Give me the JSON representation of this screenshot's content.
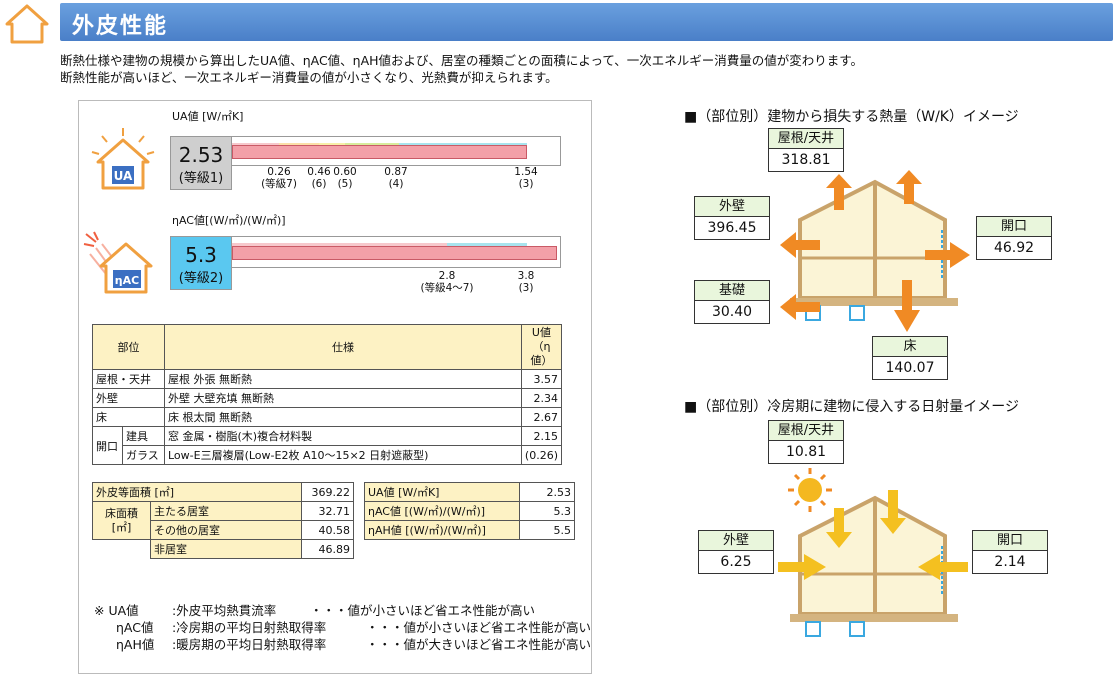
{
  "header": {
    "title": "外皮性能"
  },
  "description": [
    "断熱仕様や建物の規模から算出したUA値、ηAC値、ηAH値および、居室の種類ごとの面積によって、一次エネルギー消費量の値が変わります。",
    "断熱性能が高いほど、一次エネルギー消費量の値が小さくなり、光熱費が抑えられます。"
  ],
  "ua": {
    "label": "UA値 [W/㎡K]",
    "value": "2.53",
    "grade": "(等級1)",
    "value_fraction": 0.9,
    "ticks": [
      "0.26",
      "0.46",
      "0.60",
      "0.87",
      "1.54"
    ],
    "grades": [
      "(等級7)",
      "(6)",
      "(5)",
      "(4)",
      "(3)"
    ],
    "icon_text": "UA"
  },
  "eta_ac": {
    "label": "ηAC値[(W/㎡)/(W/㎡)]",
    "value": "5.3",
    "grade": "(等級2)",
    "value_fraction": 0.99,
    "ticks": [
      "2.8",
      "3.8"
    ],
    "grades": [
      "(等級4〜7)",
      "(3)"
    ],
    "icon_text": "ηAC"
  },
  "spec_table": {
    "headers": {
      "part": "部位",
      "spec": "仕様",
      "u": "U値",
      "u_sub": "（η値）"
    },
    "rows": [
      {
        "part": "屋根・天井",
        "spec": "屋根 外張 無断熱",
        "u": "3.57"
      },
      {
        "part": "外壁",
        "spec": "外壁 大壁充填 無断熱",
        "u": "2.34"
      },
      {
        "part": "床",
        "spec": "床 根太間 無断熱",
        "u": "2.67"
      },
      {
        "part": "開口",
        "sub": "建具",
        "spec": "窓 金属・樹脂(木)複合材料製",
        "u": "2.15"
      },
      {
        "part": "",
        "sub": "ガラス",
        "spec": "Low-E三層複層(Low-E2枚 A10〜15×2 日射遮蔽型)",
        "u": "(0.26)"
      }
    ]
  },
  "area_table": {
    "envelope_label": "外皮等面積 [㎡]",
    "envelope_value": "369.22",
    "floor_label": "床面積",
    "floor_unit": "[㎡]",
    "rows": [
      {
        "label": "主たる居室",
        "value": "32.71"
      },
      {
        "label": "その他の居室",
        "value": "40.58"
      },
      {
        "label": "非居室",
        "value": "46.89"
      }
    ]
  },
  "value_table": [
    {
      "label": "UA値 [W/㎡K]",
      "value": "2.53"
    },
    {
      "label": "ηAC値 [(W/㎡)/(W/㎡)]",
      "value": "5.3"
    },
    {
      "label": "ηAH値 [(W/㎡)/(W/㎡)]",
      "value": "5.5"
    }
  ],
  "notes": [
    {
      "key": "※ UA値",
      "def": ":外皮平均熱貫流率",
      "remark": "・・・値が小さいほど省エネ性能が高い"
    },
    {
      "key": "ηAC値",
      "def": ":冷房期の平均日射熱取得率",
      "remark": "・・・値が小さいほど省エネ性能が高い"
    },
    {
      "key": "ηAH値",
      "def": ":暖房期の平均日射熱取得率",
      "remark": "・・・値が大きいほど省エネ性能が高い"
    }
  ],
  "heat_loss": {
    "title": "■（部位別）建物から損失する熱量（W/K）イメージ",
    "roof": {
      "label": "屋根/天井",
      "value": "318.81"
    },
    "wall": {
      "label": "外壁",
      "value": "396.45"
    },
    "opening": {
      "label": "開口",
      "value": "46.92"
    },
    "foundation": {
      "label": "基礎",
      "value": "30.40"
    },
    "floor": {
      "label": "床",
      "value": "140.07"
    }
  },
  "solar_gain": {
    "title": "■（部位別）冷房期に建物に侵入する日射量イメージ",
    "roof": {
      "label": "屋根/天井",
      "value": "10.81"
    },
    "wall": {
      "label": "外壁",
      "value": "6.25"
    },
    "opening": {
      "label": "開口",
      "value": "2.14"
    }
  },
  "colors": {
    "header": "#4a7fc8",
    "arrow_out": "#f08a24",
    "arrow_in": "#f4c020",
    "house_fill": "#fbf4d6",
    "table_header": "#fdf2c4",
    "value_box_ua": "#cfcfcf",
    "value_box_ac": "#5ac8f0"
  }
}
